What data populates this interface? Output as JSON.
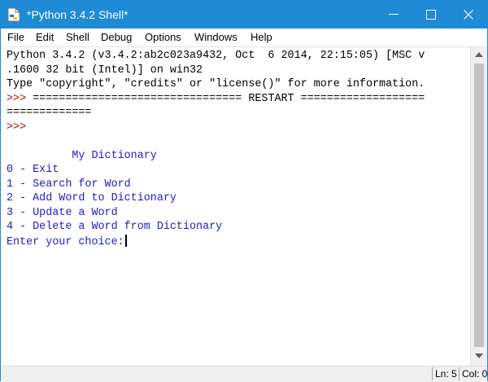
{
  "window": {
    "title": "*Python 3.4.2 Shell*",
    "icons": {
      "app": "python-file-icon",
      "minimize": "minimize-icon",
      "maximize": "maximize-icon",
      "close": "close-icon"
    },
    "accent": "#1f8ad6"
  },
  "menubar": {
    "items": [
      "File",
      "Edit",
      "Shell",
      "Debug",
      "Options",
      "Windows",
      "Help"
    ]
  },
  "shell": {
    "banner1": "Python 3.4.2 (v3.4.2:ab2c023a9432, Oct  6 2014, 22:15:05) [MSC v",
    "banner2": ".1600 32 bit (Intel)] on win32",
    "banner3": "Type \"copyright\", \"credits\" or \"license()\" for more information.",
    "prompt": ">>> ",
    "restart1": "================================ RESTART ===================",
    "restart2": "=============",
    "prompt2": ">>> ",
    "menu_title": "          My Dictionary",
    "options": [
      "0 - Exit",
      "1 - Search for Word",
      "2 - Add Word to Dictionary",
      "3 - Update a Word",
      "4 - Delete a Word from Dictionary"
    ],
    "input_prompt": "Enter your choice:",
    "colors": {
      "prompt": "#c00000",
      "output": "#2020c0",
      "text": "#000000"
    }
  },
  "statusbar": {
    "line": "Ln: 5",
    "column": "Col: 0"
  }
}
